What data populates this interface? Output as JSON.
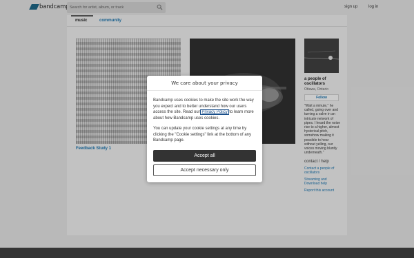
{
  "header": {
    "logo_text": "bandcamp",
    "search_placeholder": "Search for artist, album, or track",
    "signup_label": "sign up",
    "login_label": "log in"
  },
  "tabs": {
    "music": "music",
    "community": "community"
  },
  "release": {
    "title": "Feedback Study 1"
  },
  "band": {
    "name": "a people of oscillators",
    "location": "Ottawa, Ontario",
    "follow_label": "Follow",
    "quote": "\"Wait a minute,\" he called, going over and turning a valve in an intricate network of pipes. I heard the noise rise to a higher, almost hysterical pitch, somehow making it possible to hear without yelling, our voices moving bluntly underneath.\"",
    "contact_heading": "contact / help",
    "contact_link": "Contact a people of oscillators",
    "streaming_link": "Streaming and Download help",
    "report_link": "Report this account"
  },
  "dialog": {
    "title": "We care about your privacy",
    "p1_before": "Bandcamp uses cookies to make the site work the way you expect and to better understand how our users access the site. Read our ",
    "p1_link": "Privacy Policy",
    "p1_after": " to learn more about how Bandcamp uses cookies.",
    "p2": "You can update your cookie settings at any time by clicking the \"Cookie settings\" link at the bottom of any Bandcamp page.",
    "accept_all": "Accept all",
    "accept_necessary": "Accept necessary only"
  }
}
